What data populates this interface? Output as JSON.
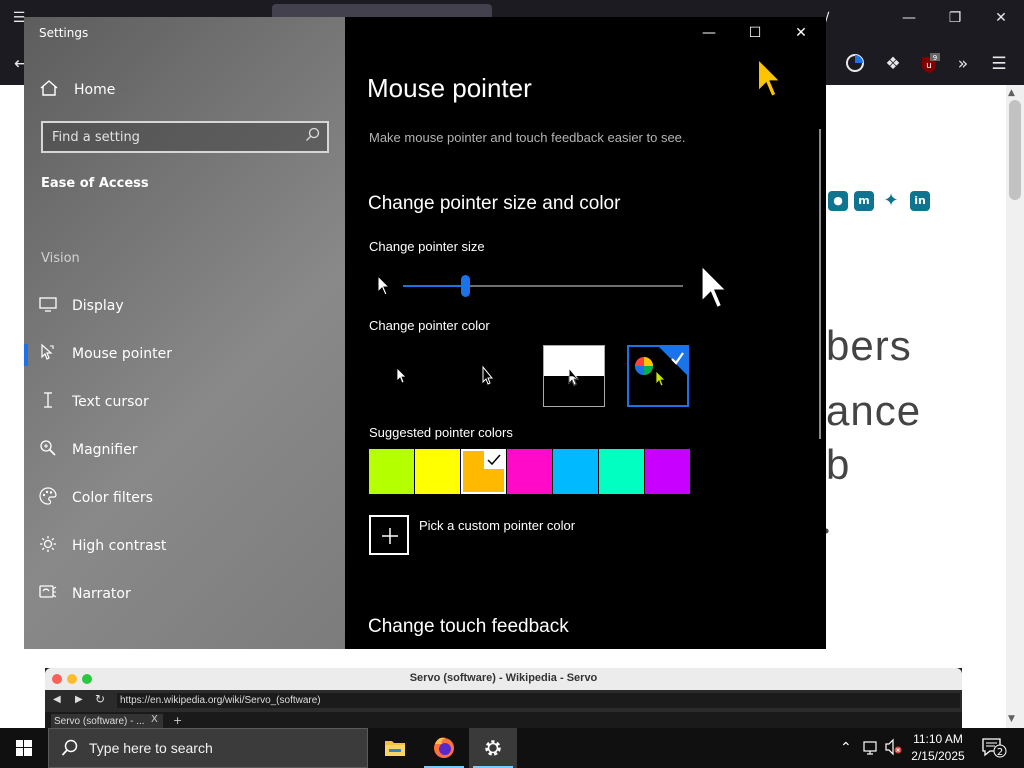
{
  "background_browser": {
    "hero_lines": [
      "bers",
      "ance",
      "b"
    ],
    "hero_dot": "•",
    "extension_badge": "9"
  },
  "settings": {
    "window_title": "Settings",
    "home_label": "Home",
    "search_placeholder": "Find a setting",
    "section_title": "Ease of Access",
    "group_title": "Vision",
    "nav_items": [
      {
        "label": "Display",
        "icon": "display-icon"
      },
      {
        "label": "Mouse pointer",
        "icon": "mouse-pointer-icon",
        "active": true
      },
      {
        "label": "Text cursor",
        "icon": "text-cursor-icon"
      },
      {
        "label": "Magnifier",
        "icon": "magnifier-icon"
      },
      {
        "label": "Color filters",
        "icon": "color-filters-icon"
      },
      {
        "label": "High contrast",
        "icon": "high-contrast-icon"
      },
      {
        "label": "Narrator",
        "icon": "narrator-icon"
      }
    ],
    "page_title": "Mouse pointer",
    "page_description": "Make mouse pointer and touch feedback easier to see.",
    "section_size_color": "Change pointer size and color",
    "pointer_size_label": "Change pointer size",
    "pointer_size_value": 0.22,
    "pointer_color_label": "Change pointer color",
    "pointer_color_options": [
      "white",
      "black",
      "inverted",
      "custom"
    ],
    "pointer_color_selected": "custom",
    "suggested_label": "Suggested pointer colors",
    "suggested_colors": [
      "#b4ff00",
      "#ffff00",
      "#ffb900",
      "#ff0ac8",
      "#00b9ff",
      "#00ffc0",
      "#c800ff"
    ],
    "suggested_selected": 2,
    "custom_color_label": "Pick a custom pointer color",
    "touch_feedback_title": "Change touch feedback",
    "accent_color": "#1a73e8",
    "cursor_color": "#ffc400"
  },
  "servo": {
    "title": "Servo (software) - Wikipedia - Servo",
    "url": "https://en.wikipedia.org/wiki/Servo_(software)",
    "tab_label": "Servo (software) - ...",
    "tab_close": "X",
    "tab_add": "+"
  },
  "taskbar": {
    "search_placeholder": "Type here to search",
    "time": "11:10 AM",
    "date": "2/15/2025",
    "notification_count": "2"
  }
}
